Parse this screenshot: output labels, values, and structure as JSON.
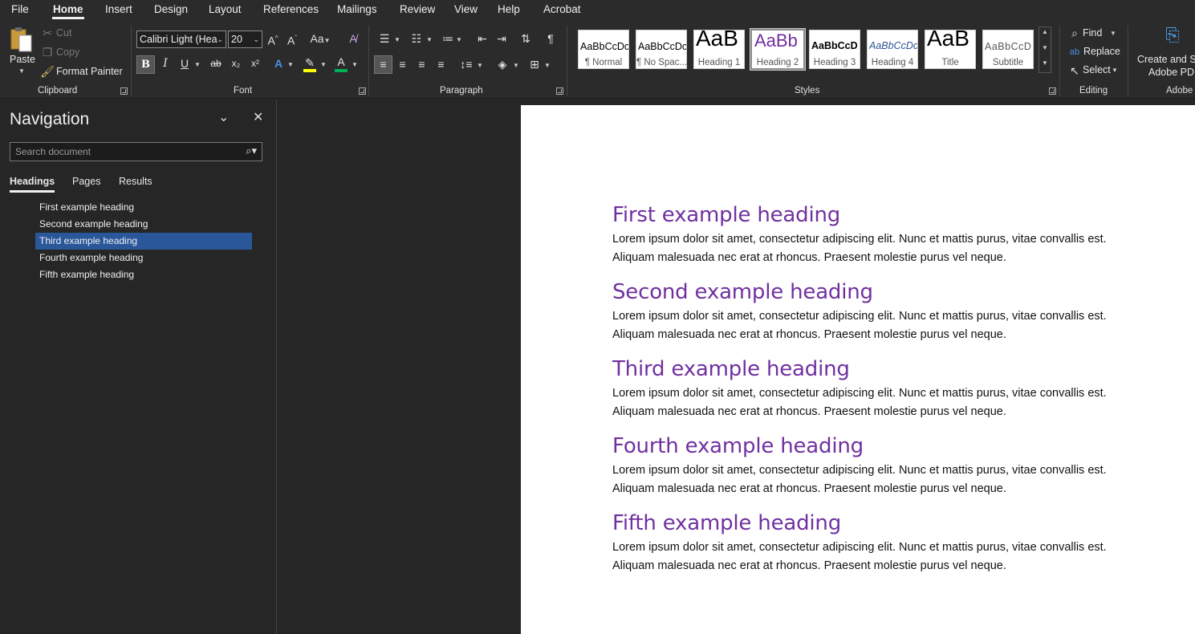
{
  "menu": {
    "tabs": [
      "File",
      "Home",
      "Insert",
      "Design",
      "Layout",
      "References",
      "Mailings",
      "Review",
      "View",
      "Help",
      "Acrobat"
    ],
    "active": "Home"
  },
  "ribbon": {
    "clipboard": {
      "label": "Clipboard",
      "paste": "Paste",
      "cut": "Cut",
      "copy": "Copy",
      "format_painter": "Format Painter"
    },
    "font": {
      "label": "Font",
      "font_name": "Calibri Light (Hea",
      "font_size": "20",
      "bold": "B",
      "italic": "I",
      "underline": "U",
      "strike": "ab",
      "subscript": "x₂",
      "superscript": "x²"
    },
    "paragraph": {
      "label": "Paragraph"
    },
    "styles": {
      "label": "Styles",
      "items": [
        {
          "preview": "AaBbCcDc",
          "name": "¶ Normal"
        },
        {
          "preview": "AaBbCcDc",
          "name": "¶ No Spac..."
        },
        {
          "preview": "AaB",
          "name": "Heading 1"
        },
        {
          "preview": "AaBb",
          "name": "Heading 2"
        },
        {
          "preview": "AaBbCcD",
          "name": "Heading 3"
        },
        {
          "preview": "AaBbCcDc",
          "name": "Heading 4"
        },
        {
          "preview": "AaB",
          "name": "Title"
        },
        {
          "preview": "AaBbCcD",
          "name": "Subtitle"
        }
      ]
    },
    "editing": {
      "label": "Editing",
      "find": "Find",
      "replace": "Replace",
      "select": "Select"
    },
    "adobe": {
      "label": "Adobe",
      "line1": "Create and Sh",
      "line2": "Adobe PDF"
    }
  },
  "nav": {
    "title": "Navigation",
    "search_placeholder": "Search document",
    "tabs": [
      "Headings",
      "Pages",
      "Results"
    ],
    "items": [
      "First example heading",
      "Second example heading",
      "Third example heading",
      "Fourth example heading",
      "Fifth example heading"
    ],
    "selected_index": 2
  },
  "document": {
    "sections": [
      {
        "heading": "First example heading",
        "line1": "Lorem ipsum dolor sit amet, consectetur adipiscing elit. Nunc et mattis purus, vitae convallis est.",
        "line2": "Aliquam malesuada nec erat at rhoncus. Praesent molestie purus vel neque."
      },
      {
        "heading": "Second example heading",
        "line1": "Lorem ipsum dolor sit amet, consectetur adipiscing elit. Nunc et mattis purus, vitae convallis est.",
        "line2": "Aliquam malesuada nec erat at rhoncus. Praesent molestie purus vel neque."
      },
      {
        "heading": "Third example heading",
        "line1": "Lorem ipsum dolor sit amet, consectetur adipiscing elit. Nunc et mattis purus, vitae convallis est.",
        "line2": "Aliquam malesuada nec erat at rhoncus. Praesent molestie purus vel neque."
      },
      {
        "heading": "Fourth example heading",
        "line1": "Lorem ipsum dolor sit amet, consectetur adipiscing elit. Nunc et mattis purus, vitae convallis est.",
        "line2": "Aliquam malesuada nec erat at rhoncus. Praesent molestie purus vel neque."
      },
      {
        "heading": "Fifth example heading",
        "line1": "Lorem ipsum dolor sit amet, consectetur adipiscing elit. Nunc et mattis purus, vitae convallis est.",
        "line2": "Aliquam malesuada nec erat at rhoncus. Praesent molestie purus vel neque."
      }
    ]
  },
  "colors": {
    "heading": "#7030a0",
    "nav_selected": "#2a579a",
    "highlight": "#ffff00",
    "font_color": "#00b050"
  }
}
